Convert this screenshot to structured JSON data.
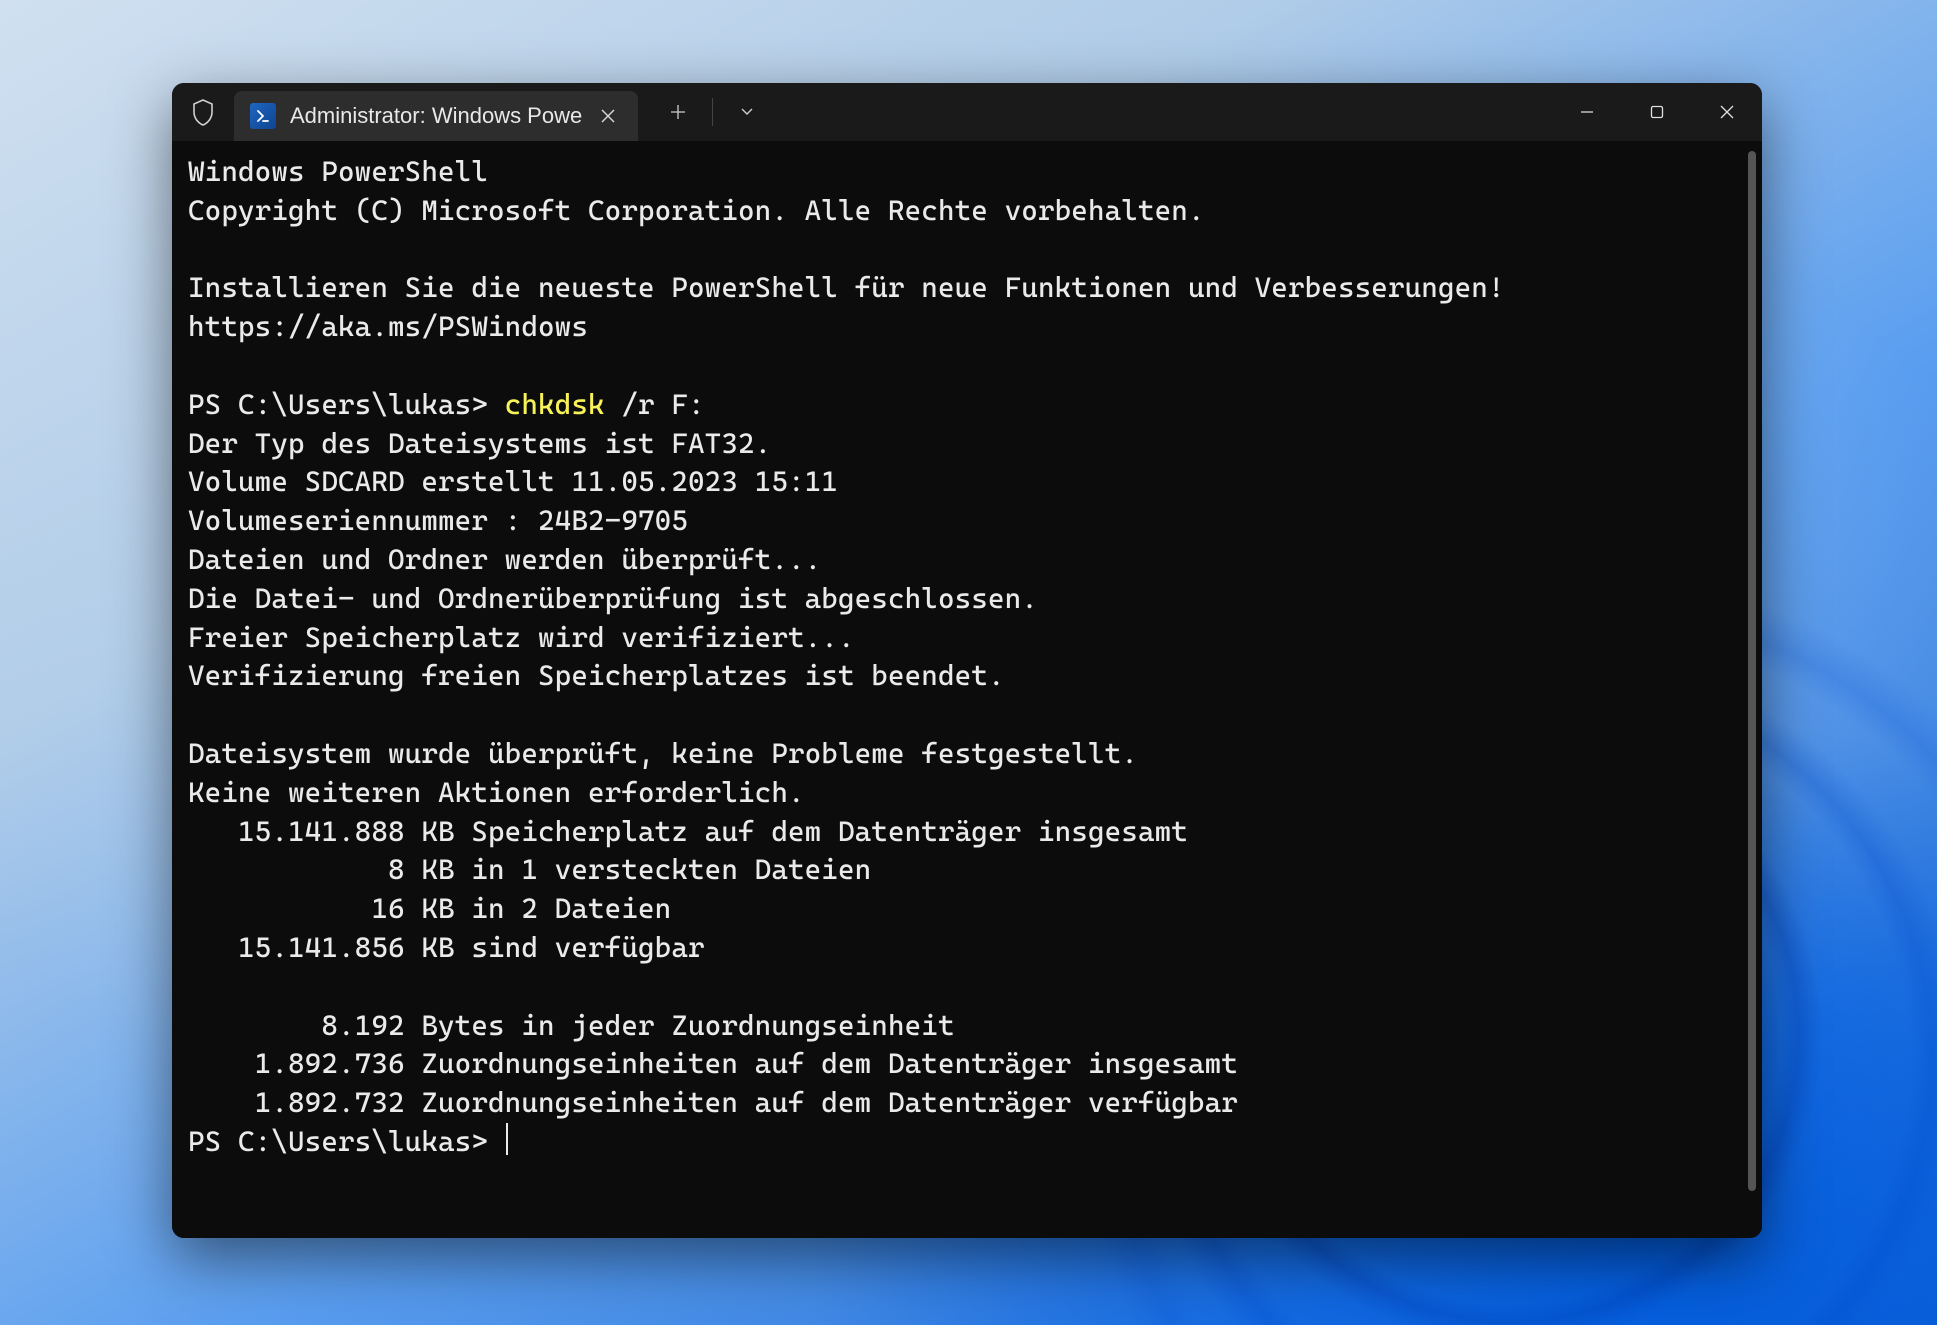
{
  "window": {
    "tab_title": "Administrator: Windows Powe",
    "controls": {
      "new_tab": "+",
      "tab_dropdown": "▾",
      "minimize": "–",
      "maximize": "□",
      "close": "✕"
    }
  },
  "terminal": {
    "banner": {
      "line1": "Windows PowerShell",
      "line2": "Copyright (C) Microsoft Corporation. Alle Rechte vorbehalten.",
      "line3": "",
      "line4": "Installieren Sie die neueste PowerShell für neue Funktionen und Verbesserungen!",
      "line5": "https://aka.ms/PSWindows"
    },
    "session": {
      "prompt1": "PS C:\\Users\\lukas> ",
      "command": "chkdsk",
      "args": " /r F:",
      "output": [
        "Der Typ des Dateisystems ist FAT32.",
        "Volume SDCARD erstellt 11.05.2023 15:11",
        "Volumeseriennummer : 24B2-9705",
        "Dateien und Ordner werden überprüft...",
        "Die Datei- und Ordnerüberprüfung ist abgeschlossen.",
        "Freier Speicherplatz wird verifiziert...",
        "Verifizierung freien Speicherplatzes ist beendet.",
        "",
        "Dateisystem wurde überprüft, keine Probleme festgestellt.",
        "Keine weiteren Aktionen erforderlich.",
        "   15.141.888 KB Speicherplatz auf dem Datenträger insgesamt",
        "            8 KB in 1 versteckten Dateien",
        "           16 KB in 2 Dateien",
        "   15.141.856 KB sind verfügbar",
        "",
        "        8.192 Bytes in jeder Zuordnungseinheit",
        "    1.892.736 Zuordnungseinheiten auf dem Datenträger insgesamt",
        "    1.892.732 Zuordnungseinheiten auf dem Datenträger verfügbar"
      ],
      "prompt2": "PS C:\\Users\\lukas> "
    }
  }
}
